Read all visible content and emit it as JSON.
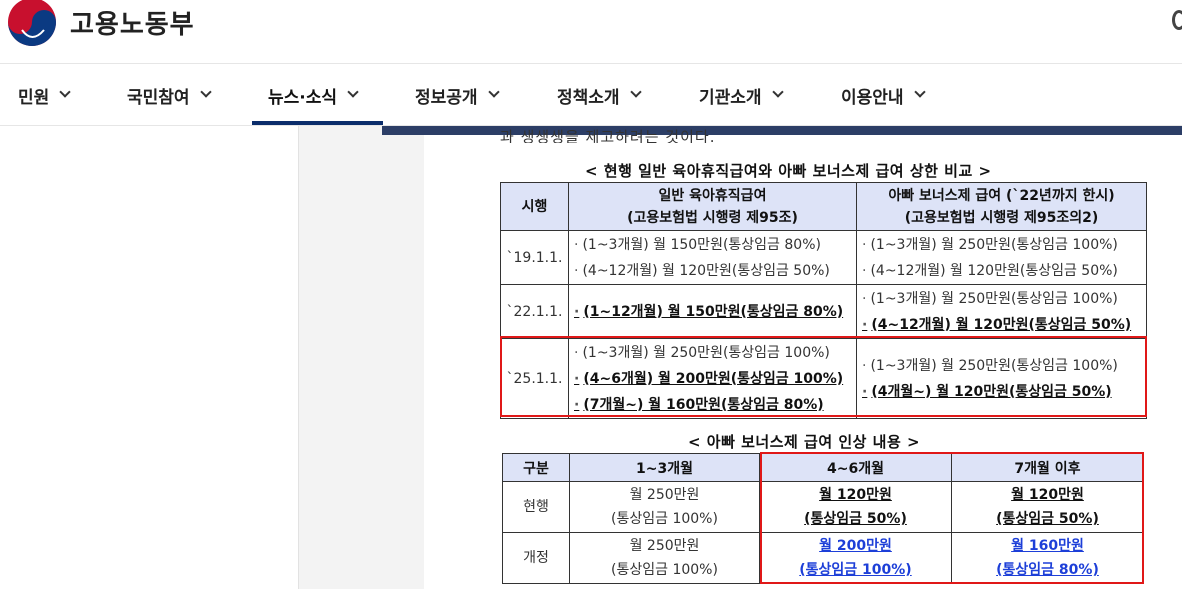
{
  "header": {
    "org_name": "고용노동부"
  },
  "nav": {
    "items": [
      {
        "label": "민원"
      },
      {
        "label": "국민참여"
      },
      {
        "label": "뉴스·소식"
      },
      {
        "label": "정보공개"
      },
      {
        "label": "정책소개"
      },
      {
        "label": "기관소개"
      },
      {
        "label": "이용안내"
      }
    ],
    "active_index": 2
  },
  "doc": {
    "cut_text": "과 생생생을 제고하려는 것이다.",
    "table1": {
      "caption": "< 현행 일반 육아휴직급여와 아빠 보너스제 급여 상한 비교 >",
      "headers": {
        "date": "시행",
        "general_line1": "일반 육아휴직급여",
        "general_line2": "(고용보험법 시행령 제95조)",
        "bonus_line1": "아빠 보너스제 급여 (`22년까지 한시)",
        "bonus_line2": "(고용보험법 시행령 제95조의2)"
      },
      "rows": [
        {
          "date": "`19.1.1.",
          "general": [
            "(1~3개월) 월 150만원(통상임금 80%)",
            "(4~12개월) 월 120만원(통상임금 50%)"
          ],
          "bonus": [
            "(1~3개월) 월 250만원(통상임금 100%)",
            "(4~12개월) 월 120만원(통상임금 50%)"
          ]
        },
        {
          "date": "`22.1.1.",
          "general": [
            "(1~12개월) 월 150만원(통상임금 80%)"
          ],
          "bonus": [
            "(1~3개월) 월 250만원(통상임금 100%)",
            "(4~12개월) 월 120만원(통상임금 50%)"
          ]
        },
        {
          "date": "`25.1.1.",
          "general": [
            "(1~3개월) 월 250만원(통상임금 100%)",
            "(4~6개월) 월 200만원(통상임금 100%)",
            "(7개월~) 월 160만원(통상임금 80%)"
          ],
          "bonus": [
            "(1~3개월) 월 250만원(통상임금 100%)",
            "(4개월~) 월 120만원(통상임금 50%)"
          ]
        }
      ]
    },
    "table2": {
      "caption": "< 아빠 보너스제 급여 인상 내용 >",
      "headers": [
        "구분",
        "1~3개월",
        "4~6개월",
        "7개월 이후"
      ],
      "rows": [
        {
          "label": "현행",
          "c1": {
            "amount": "월 250만원",
            "rate": "(통상임금 100%)"
          },
          "c2": {
            "amount": "월 120만원",
            "rate": "(통상임금 50%)"
          },
          "c3": {
            "amount": "월 120만원",
            "rate": "(통상임금 50%)"
          }
        },
        {
          "label": "개정",
          "c1": {
            "amount": "월 250만원",
            "rate": "(통상임금 100%)"
          },
          "c2": {
            "amount": "월 200만원",
            "rate": "(통상임금 100%)"
          },
          "c3": {
            "amount": "월 160만원",
            "rate": "(통상임금 80%)"
          }
        }
      ]
    }
  },
  "colors": {
    "header_fill": "#dde3f7",
    "highlight_border": "#e01818",
    "revised_text": "#1d3fd8",
    "nav_active": "#0b2d6b"
  }
}
